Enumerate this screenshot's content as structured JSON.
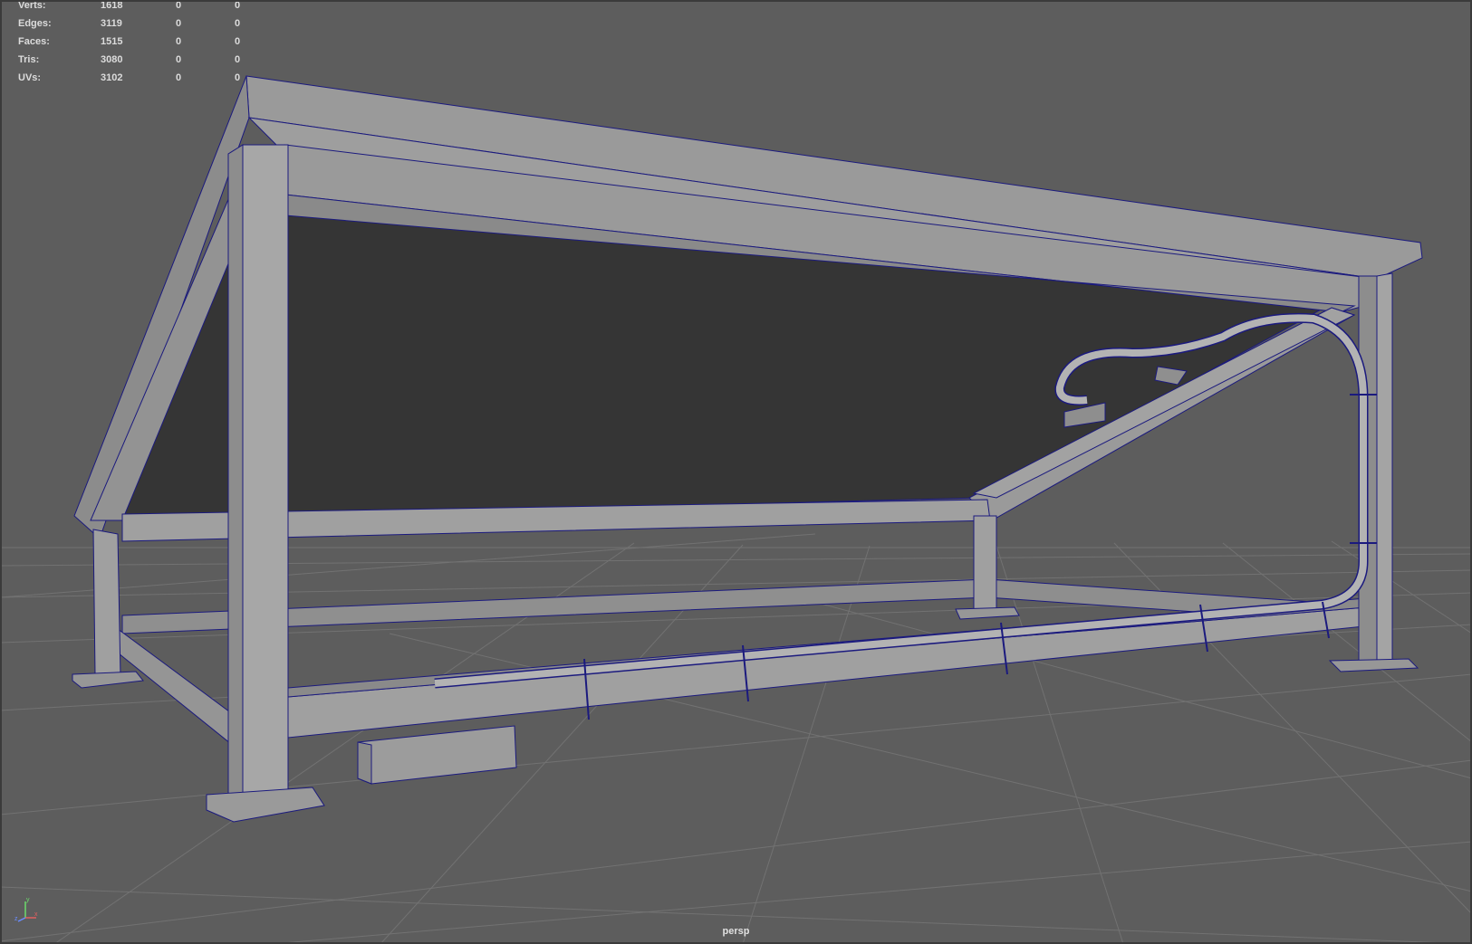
{
  "colors": {
    "background": "#5d5d5d",
    "grid": "#6e6e6e",
    "model_fill": "#979797",
    "model_shadow": "#7d7d7d",
    "panel_dark": "#353535",
    "wireframe": "#1b1a7e",
    "hud_text": "#dcdcdc"
  },
  "hud": {
    "rows": [
      {
        "label": "Verts:",
        "v1": "1618",
        "v2": "0",
        "v3": "0"
      },
      {
        "label": "Edges:",
        "v1": "3119",
        "v2": "0",
        "v3": "0"
      },
      {
        "label": "Faces:",
        "v1": "1515",
        "v2": "0",
        "v3": "0"
      },
      {
        "label": "Tris:",
        "v1": "3080",
        "v2": "0",
        "v3": "0"
      },
      {
        "label": "UVs:",
        "v1": "3102",
        "v2": "0",
        "v3": "0"
      }
    ]
  },
  "camera": {
    "label": "persp"
  },
  "axes": {
    "x": "x",
    "y": "y",
    "z": "z"
  },
  "icons": {
    "axis_gizmo": "xyz-axis-icon"
  }
}
